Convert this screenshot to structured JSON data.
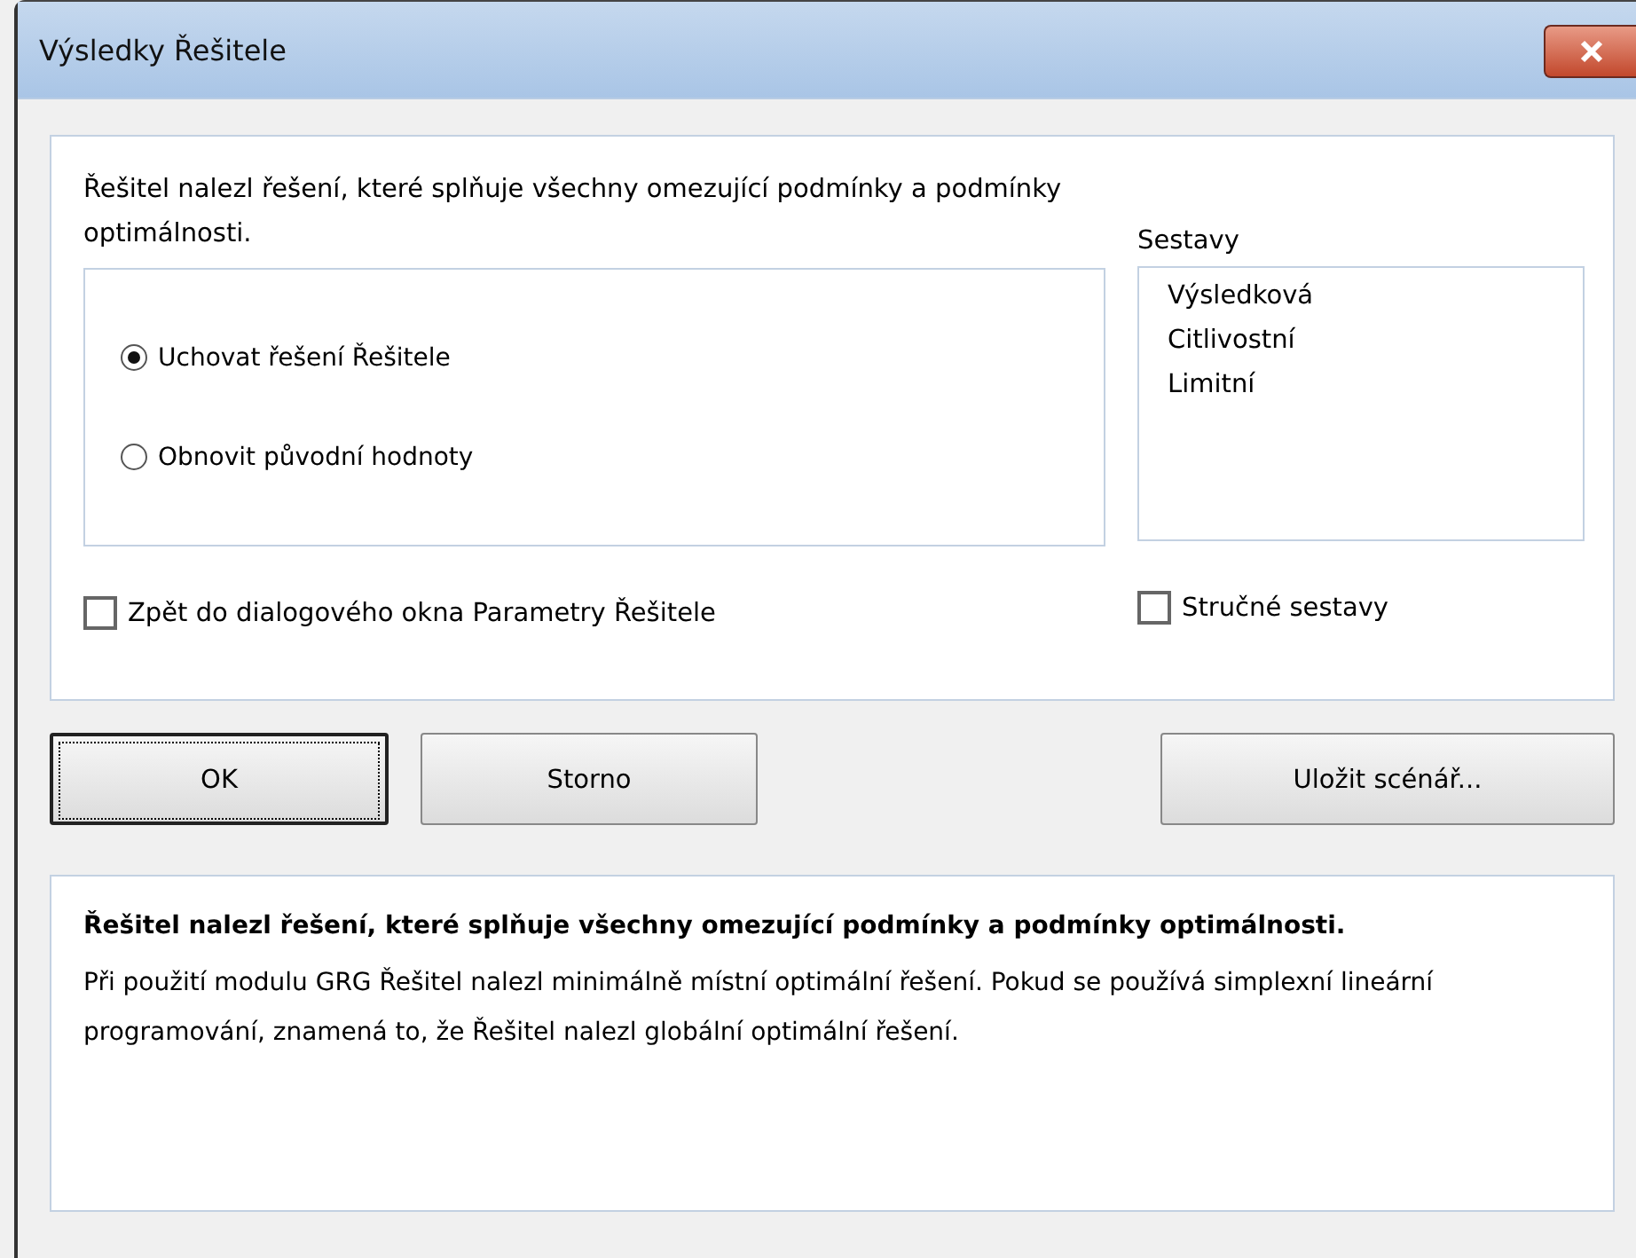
{
  "window": {
    "title": "Výsledky Řešitele"
  },
  "message": "Řešitel nalezl řešení, které splňuje všechny omezující podmínky a podmínky optimálnosti.",
  "options": [
    {
      "label": "Uchovat řešení Řešitele",
      "selected": true
    },
    {
      "label": "Obnovit původní hodnoty",
      "selected": false
    }
  ],
  "reports": {
    "label": "Sestavy",
    "items": [
      {
        "label": "Výsledková",
        "selected": false
      },
      {
        "label": "Citlivostní",
        "selected": false
      },
      {
        "label": "Limitní",
        "selected": false
      }
    ]
  },
  "return_checkbox": {
    "label": "Zpět do dialogového okna Parametry Řešitele",
    "checked": false
  },
  "outline_checkbox": {
    "label": "Stručné sestavy",
    "checked": false
  },
  "buttons": [
    {
      "label": "OK",
      "focused": true
    },
    {
      "label": "Storno",
      "focused": false
    },
    {
      "label": "Uložit scénář...",
      "focused": false
    }
  ],
  "details": {
    "heading": "Řešitel nalezl řešení, které splňuje všechny omezující podmínky a podmínky optimálnosti.",
    "body": "Při použití modulu GRG Řešitel nalezl minimálně místní optimální řešení. Pokud se používá simplexní lineární programování, znamená to, že Řešitel nalezl globální optimální řešení."
  }
}
